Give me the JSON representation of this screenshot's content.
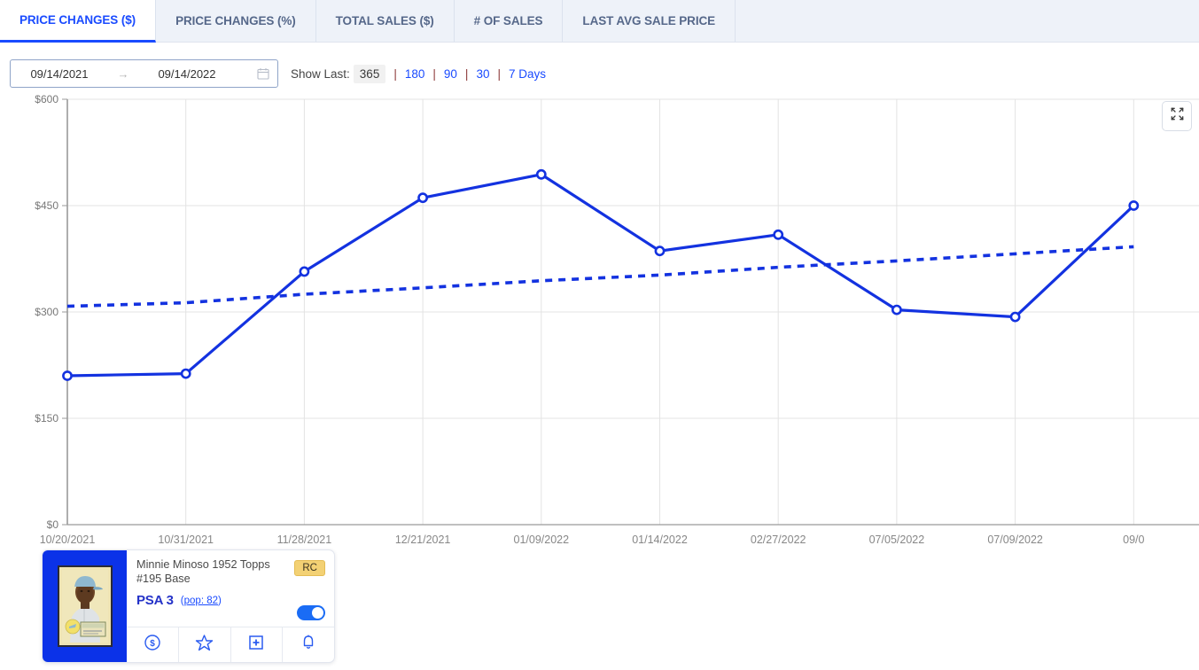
{
  "tabs": [
    {
      "label": "PRICE CHANGES ($)",
      "active": true
    },
    {
      "label": "PRICE CHANGES (%)",
      "active": false
    },
    {
      "label": "TOTAL SALES ($)",
      "active": false
    },
    {
      "label": "# OF SALES",
      "active": false
    },
    {
      "label": "LAST AVG SALE PRICE",
      "active": false
    }
  ],
  "toolbar": {
    "date_start": "09/14/2021",
    "date_end": "09/14/2022",
    "range_arrow": "→",
    "calendar_icon": "calendar-icon",
    "show_last_label": "Show Last:",
    "show_last_current": "365",
    "separator": "|",
    "show_last_options": [
      "180",
      "90",
      "30",
      "7 Days"
    ],
    "expand_icon": "fullscreen-expand-icon"
  },
  "colors": {
    "accent_blue": "#1a4bff",
    "series_blue": "#1332e0",
    "tab_inactive_bg": "#eef2f9",
    "tab_inactive_text": "#56688a",
    "grid": "#e3e3e3",
    "axis": "#9a9a9a",
    "badge_gold": "#f3d174",
    "toggle_on": "#1a6cf5"
  },
  "card": {
    "title": "Minnie Minoso 1952 Topps #195 Base",
    "badge": "RC",
    "grade": "PSA 3",
    "pop_prefix": "(",
    "pop_label": "pop: 82",
    "pop_suffix": ")",
    "toggle_on": true,
    "thumbnail_name": "baseball-card-thumbnail",
    "actions": [
      {
        "name": "price-dollar-icon",
        "label": "dollar-circle-icon"
      },
      {
        "name": "favorite-star-icon",
        "label": "star-icon"
      },
      {
        "name": "add-to-collection-icon",
        "label": "plus-square-icon"
      },
      {
        "name": "alert-bell-icon",
        "label": "bell-icon"
      }
    ]
  },
  "chart_data": {
    "type": "line",
    "title": "",
    "xlabel": "",
    "ylabel": "",
    "ylim": [
      0,
      600
    ],
    "yticks": [
      0,
      150,
      300,
      450,
      600
    ],
    "ytick_labels": [
      "$0",
      "$150",
      "$300",
      "$450",
      "$600"
    ],
    "grid": true,
    "legend": "none",
    "x": [
      "10/20/2021",
      "10/31/2021",
      "11/28/2021",
      "12/21/2021",
      "01/09/2022",
      "01/14/2022",
      "02/27/2022",
      "07/05/2022",
      "07/09/2022",
      "09/0"
    ],
    "series": [
      {
        "name": "Price",
        "style": "solid",
        "marker": "open-circle",
        "color": "#1332e0",
        "values": [
          210,
          213,
          357,
          461,
          494,
          386,
          409,
          303,
          293,
          450
        ]
      },
      {
        "name": "Trend",
        "style": "dotted",
        "marker": "none",
        "color": "#1332e0",
        "values": [
          308,
          313,
          325,
          334,
          344,
          352,
          363,
          372,
          382,
          392
        ]
      }
    ]
  }
}
